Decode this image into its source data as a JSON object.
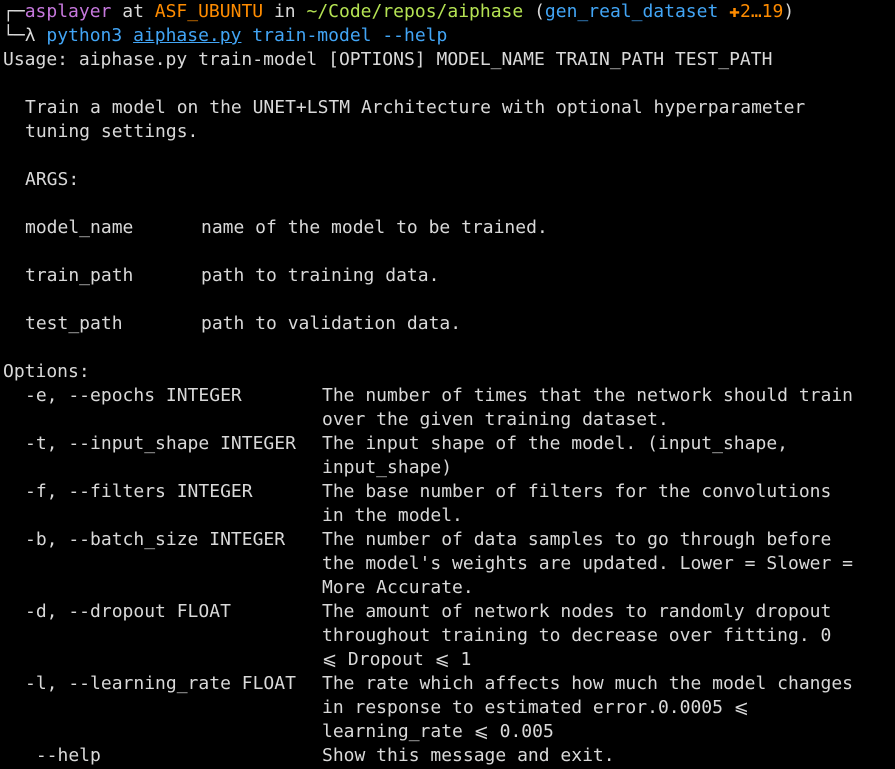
{
  "prompt": {
    "box_top": "┌─",
    "user": "asplayer",
    "at": " at ",
    "host": "ASF_UBUNTU",
    "in": " in ",
    "path": "~/Code/repos/aiphase",
    "branch_open": " (",
    "branch": "gen_real_dataset",
    "space": " ",
    "dirty": "✚2…19",
    "branch_close": ")",
    "box_bottom": "└─",
    "lambda": "λ ",
    "command": "python3",
    "script": "aiphase.py",
    "args": " train-model --help"
  },
  "usage": "Usage: aiphase.py train-model [OPTIONS] MODEL_NAME TRAIN_PATH TEST_PATH",
  "description": [
    "Train a model on the UNET+LSTM Architecture with optional hyperparameter",
    "tuning settings."
  ],
  "args_header": "ARGS:",
  "args": [
    {
      "name": "model_name",
      "desc": "name of the model to be trained."
    },
    {
      "name": "train_path",
      "desc": "path to training data."
    },
    {
      "name": "test_path",
      "desc": "path to validation data."
    }
  ],
  "options_header": "Options:",
  "options": [
    {
      "name": "-e, --epochs INTEGER",
      "desc": [
        "The number of times that the network should train",
        "over the given training dataset."
      ]
    },
    {
      "name": "-t, --input_shape INTEGER",
      "desc": [
        "The input shape of the model. (input_shape,",
        "input_shape)"
      ]
    },
    {
      "name": "-f, --filters INTEGER",
      "desc": [
        "The base number of filters for the convolutions",
        "in the model."
      ]
    },
    {
      "name": "-b, --batch_size INTEGER",
      "desc": [
        "The number of data samples to go through before",
        "the model's weights are updated. Lower = Slower =",
        "More Accurate."
      ]
    },
    {
      "name": "-d, --dropout FLOAT",
      "desc": [
        "The amount of network nodes to randomly dropout",
        "throughout training to decrease over fitting. 0",
        "⩽ Dropout ⩽ 1"
      ]
    },
    {
      "name": "-l, --learning_rate FLOAT",
      "desc": [
        "The rate which affects how much the model changes",
        "in response to estimated error.0.0005 ⩽",
        "learning_rate ⩽ 0.005"
      ]
    },
    {
      "name": " --help",
      "desc": [
        "Show this message and exit."
      ]
    }
  ]
}
